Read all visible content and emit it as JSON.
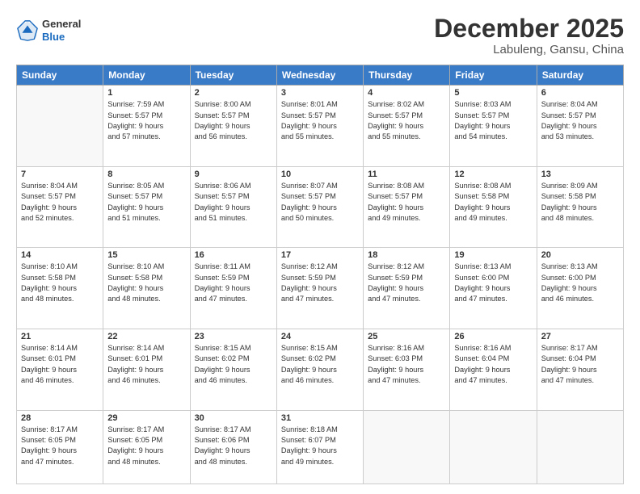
{
  "header": {
    "logo": {
      "general": "General",
      "blue": "Blue"
    },
    "title": "December 2025",
    "location": "Labuleng, Gansu, China"
  },
  "calendar": {
    "headers": [
      "Sunday",
      "Monday",
      "Tuesday",
      "Wednesday",
      "Thursday",
      "Friday",
      "Saturday"
    ],
    "weeks": [
      [
        {
          "day": "",
          "info": ""
        },
        {
          "day": "1",
          "info": "Sunrise: 7:59 AM\nSunset: 5:57 PM\nDaylight: 9 hours\nand 57 minutes."
        },
        {
          "day": "2",
          "info": "Sunrise: 8:00 AM\nSunset: 5:57 PM\nDaylight: 9 hours\nand 56 minutes."
        },
        {
          "day": "3",
          "info": "Sunrise: 8:01 AM\nSunset: 5:57 PM\nDaylight: 9 hours\nand 55 minutes."
        },
        {
          "day": "4",
          "info": "Sunrise: 8:02 AM\nSunset: 5:57 PM\nDaylight: 9 hours\nand 55 minutes."
        },
        {
          "day": "5",
          "info": "Sunrise: 8:03 AM\nSunset: 5:57 PM\nDaylight: 9 hours\nand 54 minutes."
        },
        {
          "day": "6",
          "info": "Sunrise: 8:04 AM\nSunset: 5:57 PM\nDaylight: 9 hours\nand 53 minutes."
        }
      ],
      [
        {
          "day": "7",
          "info": "Sunrise: 8:04 AM\nSunset: 5:57 PM\nDaylight: 9 hours\nand 52 minutes."
        },
        {
          "day": "8",
          "info": "Sunrise: 8:05 AM\nSunset: 5:57 PM\nDaylight: 9 hours\nand 51 minutes."
        },
        {
          "day": "9",
          "info": "Sunrise: 8:06 AM\nSunset: 5:57 PM\nDaylight: 9 hours\nand 51 minutes."
        },
        {
          "day": "10",
          "info": "Sunrise: 8:07 AM\nSunset: 5:57 PM\nDaylight: 9 hours\nand 50 minutes."
        },
        {
          "day": "11",
          "info": "Sunrise: 8:08 AM\nSunset: 5:57 PM\nDaylight: 9 hours\nand 49 minutes."
        },
        {
          "day": "12",
          "info": "Sunrise: 8:08 AM\nSunset: 5:58 PM\nDaylight: 9 hours\nand 49 minutes."
        },
        {
          "day": "13",
          "info": "Sunrise: 8:09 AM\nSunset: 5:58 PM\nDaylight: 9 hours\nand 48 minutes."
        }
      ],
      [
        {
          "day": "14",
          "info": "Sunrise: 8:10 AM\nSunset: 5:58 PM\nDaylight: 9 hours\nand 48 minutes."
        },
        {
          "day": "15",
          "info": "Sunrise: 8:10 AM\nSunset: 5:58 PM\nDaylight: 9 hours\nand 48 minutes."
        },
        {
          "day": "16",
          "info": "Sunrise: 8:11 AM\nSunset: 5:59 PM\nDaylight: 9 hours\nand 47 minutes."
        },
        {
          "day": "17",
          "info": "Sunrise: 8:12 AM\nSunset: 5:59 PM\nDaylight: 9 hours\nand 47 minutes."
        },
        {
          "day": "18",
          "info": "Sunrise: 8:12 AM\nSunset: 5:59 PM\nDaylight: 9 hours\nand 47 minutes."
        },
        {
          "day": "19",
          "info": "Sunrise: 8:13 AM\nSunset: 6:00 PM\nDaylight: 9 hours\nand 47 minutes."
        },
        {
          "day": "20",
          "info": "Sunrise: 8:13 AM\nSunset: 6:00 PM\nDaylight: 9 hours\nand 46 minutes."
        }
      ],
      [
        {
          "day": "21",
          "info": "Sunrise: 8:14 AM\nSunset: 6:01 PM\nDaylight: 9 hours\nand 46 minutes."
        },
        {
          "day": "22",
          "info": "Sunrise: 8:14 AM\nSunset: 6:01 PM\nDaylight: 9 hours\nand 46 minutes."
        },
        {
          "day": "23",
          "info": "Sunrise: 8:15 AM\nSunset: 6:02 PM\nDaylight: 9 hours\nand 46 minutes."
        },
        {
          "day": "24",
          "info": "Sunrise: 8:15 AM\nSunset: 6:02 PM\nDaylight: 9 hours\nand 46 minutes."
        },
        {
          "day": "25",
          "info": "Sunrise: 8:16 AM\nSunset: 6:03 PM\nDaylight: 9 hours\nand 47 minutes."
        },
        {
          "day": "26",
          "info": "Sunrise: 8:16 AM\nSunset: 6:04 PM\nDaylight: 9 hours\nand 47 minutes."
        },
        {
          "day": "27",
          "info": "Sunrise: 8:17 AM\nSunset: 6:04 PM\nDaylight: 9 hours\nand 47 minutes."
        }
      ],
      [
        {
          "day": "28",
          "info": "Sunrise: 8:17 AM\nSunset: 6:05 PM\nDaylight: 9 hours\nand 47 minutes."
        },
        {
          "day": "29",
          "info": "Sunrise: 8:17 AM\nSunset: 6:05 PM\nDaylight: 9 hours\nand 48 minutes."
        },
        {
          "day": "30",
          "info": "Sunrise: 8:17 AM\nSunset: 6:06 PM\nDaylight: 9 hours\nand 48 minutes."
        },
        {
          "day": "31",
          "info": "Sunrise: 8:18 AM\nSunset: 6:07 PM\nDaylight: 9 hours\nand 49 minutes."
        },
        {
          "day": "",
          "info": ""
        },
        {
          "day": "",
          "info": ""
        },
        {
          "day": "",
          "info": ""
        }
      ]
    ]
  }
}
